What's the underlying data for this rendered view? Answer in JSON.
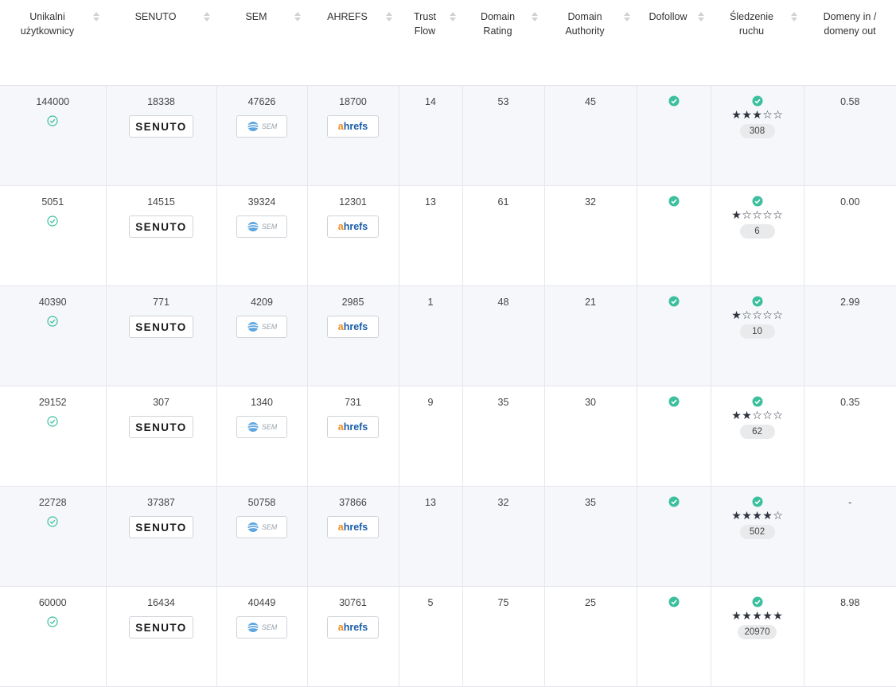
{
  "columns": [
    {
      "label": "Unikalni użytkownicy"
    },
    {
      "label": "SENUTO"
    },
    {
      "label": "SEM"
    },
    {
      "label": "AHREFS"
    },
    {
      "label": "Trust Flow"
    },
    {
      "label": "Domain Rating"
    },
    {
      "label": "Domain Authority"
    },
    {
      "label": "Dofollow"
    },
    {
      "label": "Śledzenie ruchu"
    },
    {
      "label": "Domeny in / domeny out"
    }
  ],
  "logos": {
    "senuto": "SENUTO",
    "sem": "SEM",
    "ahrefs_a": "a",
    "ahrefs_rest": "hrefs"
  },
  "colors": {
    "check": "#3cbf9e",
    "star": "#2f3340",
    "border": "#e4e6ea",
    "row_alt": "#f5f7fa"
  },
  "rows": [
    {
      "users": "144000",
      "senuto": "18338",
      "sem": "47626",
      "ahrefs": "18700",
      "trust_flow": "14",
      "domain_rating": "53",
      "domain_authority": "45",
      "rating_stars": 3,
      "traffic": "308",
      "ratio": "0.58"
    },
    {
      "users": "5051",
      "senuto": "14515",
      "sem": "39324",
      "ahrefs": "12301",
      "trust_flow": "13",
      "domain_rating": "61",
      "domain_authority": "32",
      "rating_stars": 1,
      "traffic": "6",
      "ratio": "0.00"
    },
    {
      "users": "40390",
      "senuto": "771",
      "sem": "4209",
      "ahrefs": "2985",
      "trust_flow": "1",
      "domain_rating": "48",
      "domain_authority": "21",
      "rating_stars": 1,
      "traffic": "10",
      "ratio": "2.99"
    },
    {
      "users": "29152",
      "senuto": "307",
      "sem": "1340",
      "ahrefs": "731",
      "trust_flow": "9",
      "domain_rating": "35",
      "domain_authority": "30",
      "rating_stars": 2,
      "traffic": "62",
      "ratio": "0.35"
    },
    {
      "users": "22728",
      "senuto": "37387",
      "sem": "50758",
      "ahrefs": "37866",
      "trust_flow": "13",
      "domain_rating": "32",
      "domain_authority": "35",
      "rating_stars": 4,
      "traffic": "502",
      "ratio": "-"
    },
    {
      "users": "60000",
      "senuto": "16434",
      "sem": "40449",
      "ahrefs": "30761",
      "trust_flow": "5",
      "domain_rating": "75",
      "domain_authority": "25",
      "rating_stars": 5,
      "traffic": "20970",
      "ratio": "8.98"
    }
  ]
}
